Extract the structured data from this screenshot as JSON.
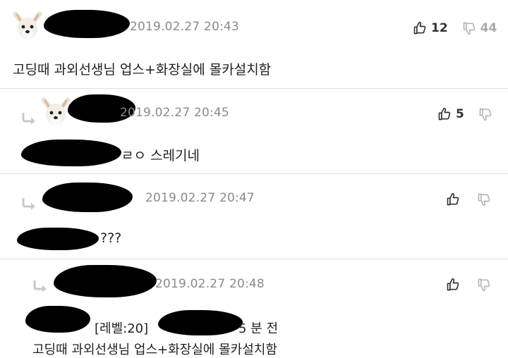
{
  "comments": [
    {
      "timestamp": "2019.02.27 20:43",
      "text": "고딩때 과외선생님 업스+화장실에 몰카설치함",
      "up_count": "12",
      "down_count": "44"
    },
    {
      "timestamp": "2019.02.27 20:45",
      "text": "ㄹㅇ 스레기네",
      "up_count": "5",
      "down_count": ""
    },
    {
      "timestamp": "2019.02.27 20:47",
      "text": "???",
      "up_count": "",
      "down_count": ""
    },
    {
      "timestamp": "2019.02.27 20:48",
      "meta_level": "[레벨:20]",
      "meta_time": "5 분 전",
      "text": "고딩때 과외선생님 업스+화장실에 몰카설치함",
      "up_count": "",
      "down_count": ""
    }
  ],
  "icons": {
    "thumb_up": "thumbs-up-icon",
    "thumb_down": "thumbs-down-icon",
    "reply": "reply-arrow-icon",
    "avatar": "dog-avatar"
  },
  "colors": {
    "timestamp": "#8a8a8a",
    "separator": "#dedede",
    "reply_arrow": "#c8c8c8"
  }
}
